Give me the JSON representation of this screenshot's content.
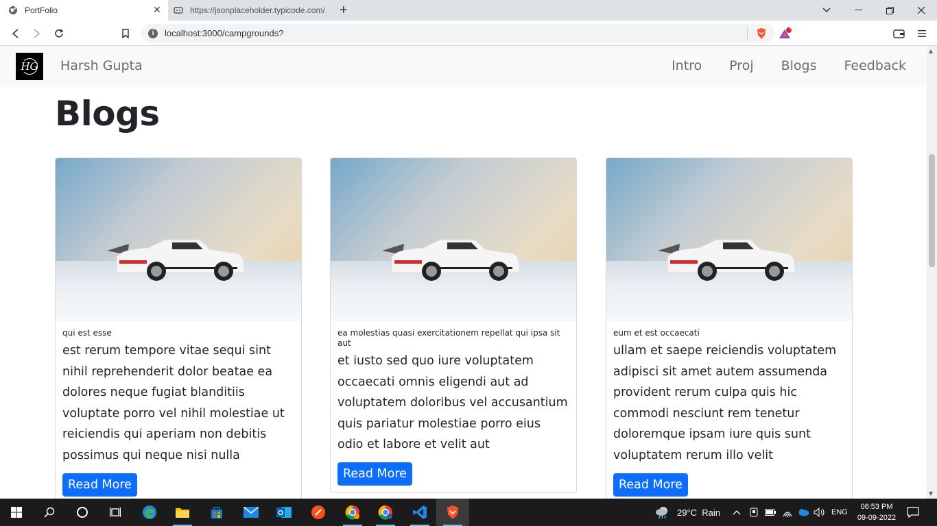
{
  "browser": {
    "tabs": [
      {
        "title": "PortFolio",
        "active": true
      },
      {
        "title": "https://jsonplaceholder.typicode.com/",
        "active": false
      }
    ],
    "url": "localhost:3000/campgrounds?",
    "rewards_badge": "1"
  },
  "navbar": {
    "logo_text": "HG",
    "brand": "Harsh Gupta",
    "links": [
      "Intro",
      "Proj",
      "Blogs",
      "Feedback"
    ]
  },
  "section": {
    "heading": "Blogs"
  },
  "cards": [
    {
      "title": "qui est esse",
      "body": "est rerum tempore vitae sequi sint nihil reprehenderit dolor beatae ea dolores neque fugiat blanditiis voluptate porro vel nihil molestiae ut reiciendis qui aperiam non debitis possimus qui neque nisi nulla",
      "button": "Read More"
    },
    {
      "title": "ea molestias quasi exercitationem repellat qui ipsa sit aut",
      "body": "et iusto sed quo iure voluptatem occaecati omnis eligendi aut ad voluptatem doloribus vel accusantium quis pariatur molestiae porro eius odio et labore et velit aut",
      "button": "Read More"
    },
    {
      "title": "eum et est occaecati",
      "body": "ullam et saepe reiciendis voluptatem adipisci sit amet autem assumenda provident rerum culpa quis hic commodi nesciunt rem tenetur doloremque ipsam iure quis sunt voluptatem rerum illo velit",
      "button": "Read More"
    }
  ],
  "taskbar": {
    "weather": "29°C  Rain",
    "lang": "ENG",
    "time": "06:53 PM",
    "date": "09-09-2022"
  },
  "colors": {
    "primary": "#0d6efd",
    "navbar_bg": "#f8f9fa",
    "taskbar_bg": "#1b1b1b"
  }
}
